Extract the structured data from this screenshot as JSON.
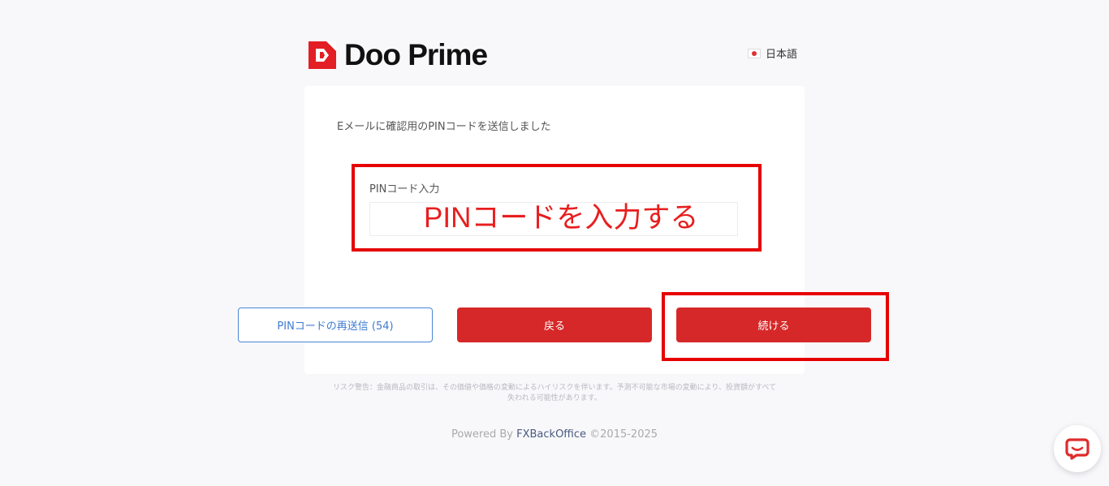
{
  "header": {
    "brand": "Doo Prime",
    "language": "日本語"
  },
  "card": {
    "info_text": "Eメールに確認用のPINコードを送信しました",
    "pin_label": "PINコード入力",
    "pin_annotation": "PINコードを入力する"
  },
  "buttons": {
    "resend": "PINコードの再送信 (54)",
    "back": "戻る",
    "continue": "続ける"
  },
  "footer": {
    "risk_line1": "リスク警告：金融商品の取引は、その価値や価格の変動によるハイリスクを伴います。予測不可能な市場の変動により、投資額がすべて",
    "risk_line2": "失われる可能性があります。",
    "powered_prefix": "Powered By ",
    "powered_brand": "FXBackOffice",
    "powered_suffix": " ©2015-2025"
  },
  "colors": {
    "accent_red": "#d62828",
    "annotation_red": "#e60000",
    "link_blue": "#3e7bd1"
  },
  "icons": {
    "logo": "doo-prime-logo-icon",
    "flag": "japan-flag-icon",
    "chat": "chat-bubble-icon"
  }
}
